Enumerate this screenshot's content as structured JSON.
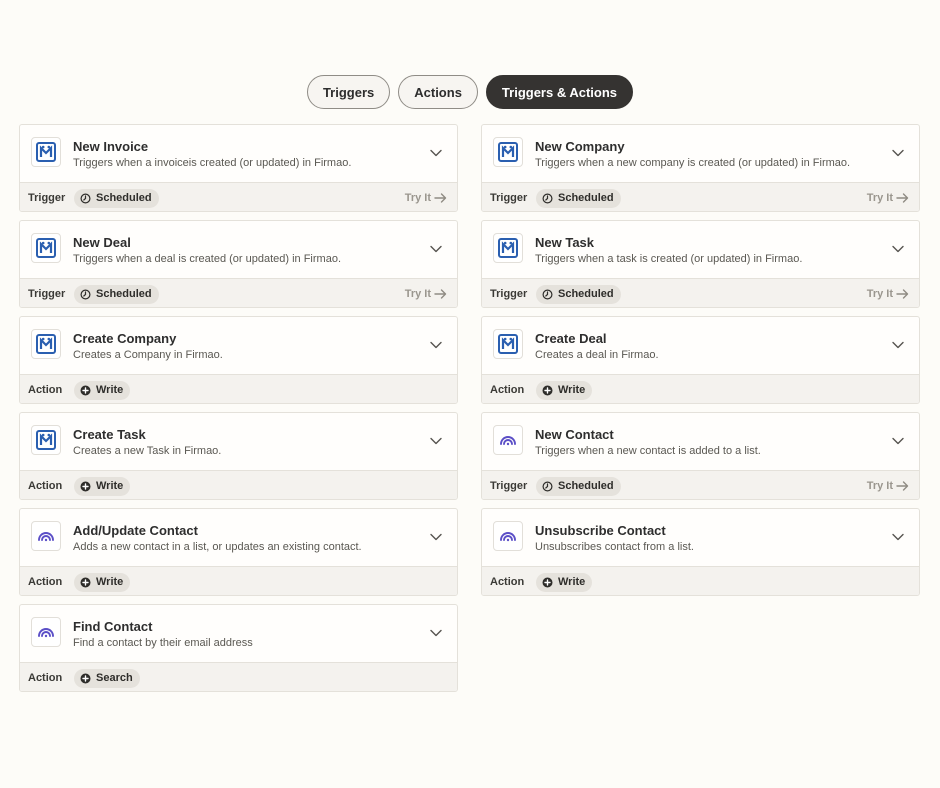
{
  "tabs": [
    {
      "label": "Triggers"
    },
    {
      "label": "Actions"
    },
    {
      "label": "Triggers & Actions"
    }
  ],
  "try_it_label": "Try It",
  "colors": {
    "firmao_blue": "#2a5fb0",
    "contact_purple": "#5b4fc7",
    "active_tab": "#353331"
  },
  "cards": [
    {
      "title": "New Invoice",
      "description": "Triggers when a invoiceis created (or updated) in Firmao.",
      "kind": "Trigger",
      "badge": "Scheduled",
      "app_icon": "firmao-logo-icon",
      "badge_icon": "clock-icon"
    },
    {
      "title": "New Company",
      "description": "Triggers when a new company is created (or updated) in Firmao.",
      "kind": "Trigger",
      "badge": "Scheduled",
      "app_icon": "firmao-logo-icon",
      "badge_icon": "clock-icon"
    },
    {
      "title": "New Deal",
      "description": "Triggers when a deal is created (or updated) in Firmao.",
      "kind": "Trigger",
      "badge": "Scheduled",
      "app_icon": "firmao-logo-icon",
      "badge_icon": "clock-icon"
    },
    {
      "title": "New Task",
      "description": "Triggers when a task is created (or updated) in Firmao.",
      "kind": "Trigger",
      "badge": "Scheduled",
      "app_icon": "firmao-logo-icon",
      "badge_icon": "clock-icon"
    },
    {
      "title": "Create Company",
      "description": "Creates a Company in Firmao.",
      "kind": "Action",
      "badge": "Write",
      "app_icon": "firmao-logo-icon",
      "badge_icon": "plus-circle-icon"
    },
    {
      "title": "Create Deal",
      "description": "Creates a deal in Firmao.",
      "kind": "Action",
      "badge": "Write",
      "app_icon": "firmao-logo-icon",
      "badge_icon": "plus-circle-icon"
    },
    {
      "title": "Create Task",
      "description": "Creates a new Task in Firmao.",
      "kind": "Action",
      "badge": "Write",
      "app_icon": "firmao-logo-icon",
      "badge_icon": "plus-circle-icon"
    },
    {
      "title": "New Contact",
      "description": "Triggers when a new contact is added to a list.",
      "kind": "Trigger",
      "badge": "Scheduled",
      "app_icon": "contact-app-logo-icon",
      "badge_icon": "clock-icon"
    },
    {
      "title": "Add/Update Contact",
      "description": "Adds a new contact in a list, or updates an existing contact.",
      "kind": "Action",
      "badge": "Write",
      "app_icon": "contact-app-logo-icon",
      "badge_icon": "plus-circle-icon"
    },
    {
      "title": "Unsubscribe Contact",
      "description": "Unsubscribes contact from a list.",
      "kind": "Action",
      "badge": "Write",
      "app_icon": "contact-app-logo-icon",
      "badge_icon": "plus-circle-icon"
    },
    {
      "title": "Find Contact",
      "description": "Find a contact by their email address",
      "kind": "Action",
      "badge": "Search",
      "app_icon": "contact-app-logo-icon",
      "badge_icon": "plus-circle-icon"
    }
  ]
}
